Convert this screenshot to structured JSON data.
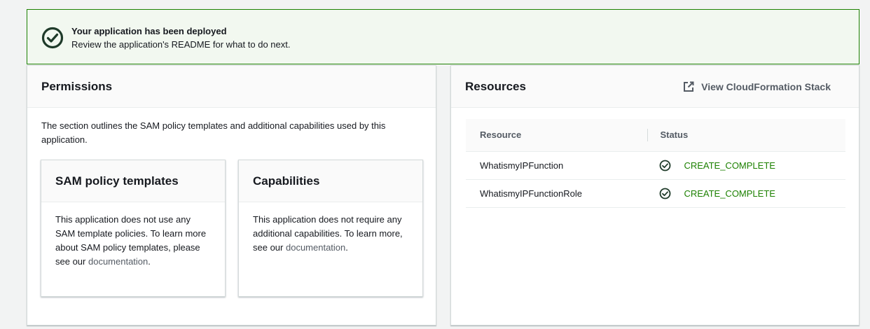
{
  "banner": {
    "title": "Your application has been deployed",
    "subtitle": "Review the application's README for what to do next.",
    "icon": "success-check-icon",
    "accent_color": "#1d8102"
  },
  "permissions": {
    "title": "Permissions",
    "description": "The section outlines the SAM policy templates and additional capabilities used by this application.",
    "sam_card": {
      "title": "SAM policy templates",
      "body_prefix": "This application does not use any SAM template policies. To learn more about SAM policy templates, please see our ",
      "link_text": "documentation",
      "body_suffix": "."
    },
    "capabilities_card": {
      "title": "Capabilities",
      "body_prefix": "This application does not require any additional capabilities. To learn more, see our ",
      "link_text": "documentation",
      "body_suffix": "."
    }
  },
  "resources": {
    "title": "Resources",
    "stack_link": "View CloudFormation Stack",
    "stack_link_icon": "external-link-icon",
    "columns": [
      "Resource",
      "Status"
    ],
    "rows": [
      {
        "resource": "WhatismyIPFunction",
        "status": "CREATE_COMPLETE"
      },
      {
        "resource": "WhatismyIPFunctionRole",
        "status": "CREATE_COMPLETE"
      }
    ],
    "status_color": "#1d8102"
  }
}
